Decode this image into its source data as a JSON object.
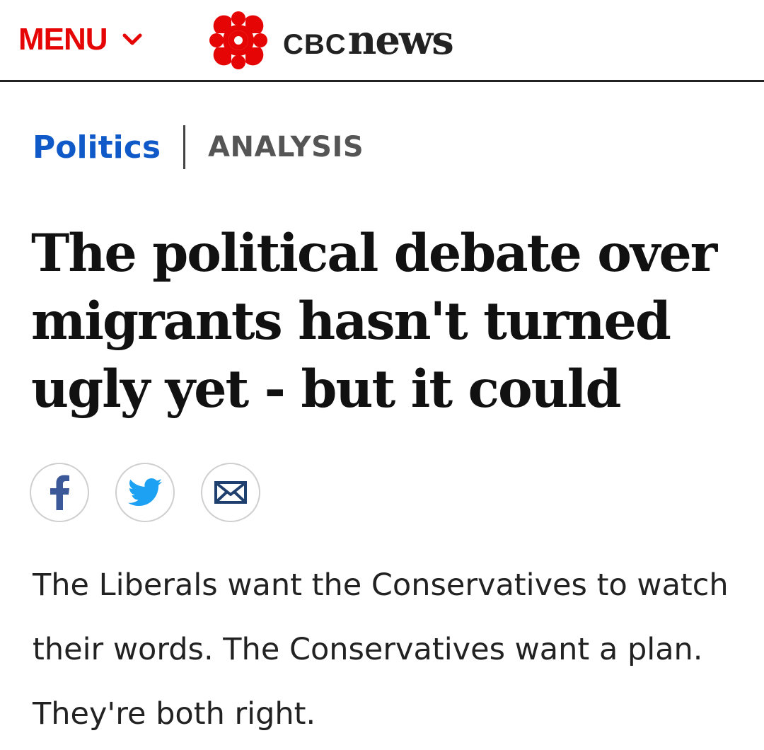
{
  "header": {
    "menu_label": "MENU",
    "menu_icon": "chevron-down-icon",
    "logo": {
      "icon": "cbc-gem-logo",
      "brand_cbc": "CBC",
      "brand_news": "news"
    }
  },
  "article": {
    "section": "Politics",
    "label": "ANALYSIS",
    "headline": "The political debate over migrants hasn't turned ugly yet - but it could",
    "share_buttons": [
      {
        "icon": "facebook-icon"
      },
      {
        "icon": "twitter-icon"
      },
      {
        "icon": "email-icon"
      }
    ],
    "dek": "The Liberals want the Conservatives to watch their words. The Conservatives want a plan. They're both right."
  },
  "colors": {
    "brand_red": "#e60505",
    "section_blue": "#0f5ac8",
    "facebook_blue": "#3b5998",
    "twitter_blue": "#1da1f2",
    "email_blue": "#1f3f6e"
  }
}
